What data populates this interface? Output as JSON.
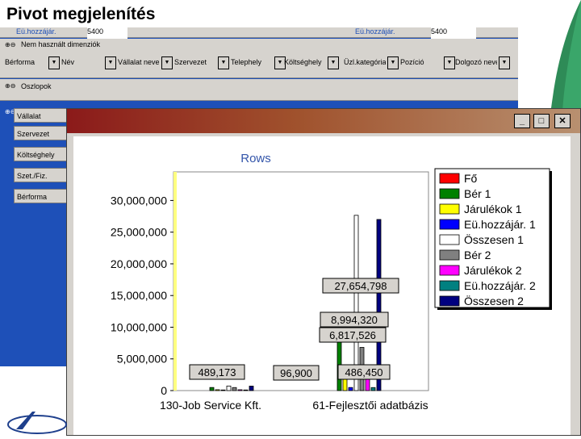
{
  "slide": {
    "title": "Pivot megjelenítés"
  },
  "pivot": {
    "top_fields": [
      {
        "label": "Eü.hozzájár.",
        "value": "5400"
      },
      {
        "label": "Eü.hozzájár.",
        "value": "5400"
      }
    ],
    "dimensions_label": "Nem használt dimenziók",
    "dimension_fields": [
      "Bérforma",
      "Név",
      "Vállalat neve",
      "Szervezet",
      "Telephely",
      "Költséghely",
      "Üzl.kategória",
      "Pozíció",
      "Dolgozó neve"
    ],
    "columns_label": "Oszlopok",
    "side_fields": [
      "Vállalat",
      "Szervezet",
      "Költséghely",
      "Szet./Fiz.",
      "Bérforma"
    ]
  },
  "window": {
    "minimize": "_",
    "maximize": "□",
    "close": "✕"
  },
  "chart_data": {
    "type": "bar",
    "title": "Rows",
    "categories": [
      "130-Job Service Kft.",
      "61-Fejlesztői adatbázis"
    ],
    "series": [
      {
        "name": "Fő",
        "color": "#ff0000",
        "values": [
          0,
          0
        ]
      },
      {
        "name": "Bér 1",
        "color": "#008000",
        "values": [
          489173,
          8994320
        ]
      },
      {
        "name": "Járulékok 1",
        "color": "#ffff00",
        "values": [
          135000,
          2500000
        ]
      },
      {
        "name": "Eü.hozzájár. 1",
        "color": "#0000ff",
        "values": [
          96900,
          486450
        ]
      },
      {
        "name": "Összesen 1",
        "color": "#ffffff",
        "values": [
          721073,
          27654798
        ]
      },
      {
        "name": "Bér 2",
        "color": "#808080",
        "values": [
          480000,
          6817526
        ]
      },
      {
        "name": "Járulékok 2",
        "color": "#ff00ff",
        "values": [
          130000,
          2000000
        ]
      },
      {
        "name": "Eü.hozzájár. 2",
        "color": "#008080",
        "values": [
          96000,
          480000
        ]
      },
      {
        "name": "Összesen 2",
        "color": "#000080",
        "values": [
          706000,
          27000000
        ]
      }
    ],
    "labels": [
      "27,654,798",
      "8,994,320",
      "6,817,526",
      "489,173",
      "96,900",
      "486,450"
    ],
    "yticks": [
      "0",
      "5,000,000",
      "10,000,000",
      "15,000,000",
      "20,000,000",
      "25,000,000",
      "30,000,000"
    ],
    "ylim": [
      0,
      34000000
    ],
    "legend": "right"
  }
}
